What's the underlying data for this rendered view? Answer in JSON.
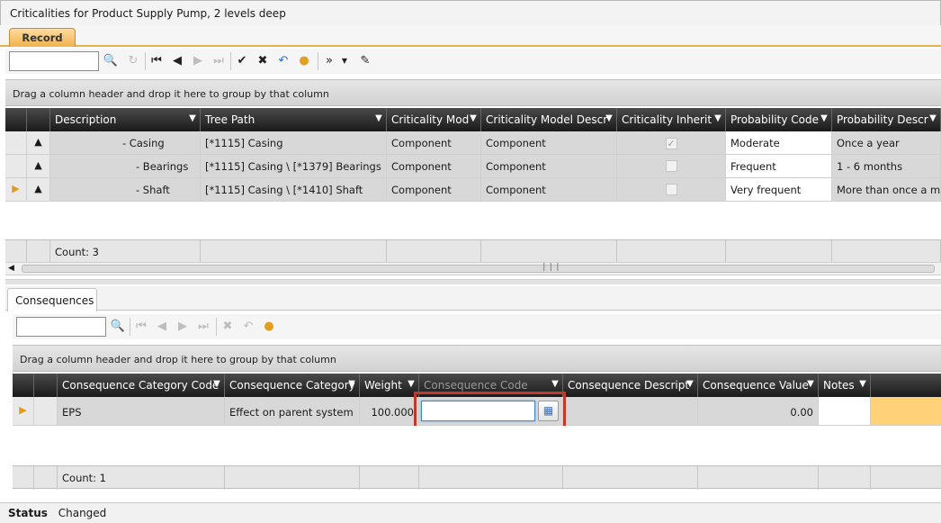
{
  "window": {
    "title": "Criticalities for Product Supply Pump, 2 levels deep"
  },
  "tabs": {
    "record": "Record",
    "consequences": "Consequences"
  },
  "group_panel_text": "Drag a column header and drop it here to group by that column",
  "top_grid": {
    "columns": [
      "Description",
      "Tree Path",
      "Criticality Mod",
      "Criticality Model Descr",
      "Criticality Inherit",
      "Probability Code",
      "Probability Descr"
    ],
    "rows": [
      {
        "description": "- Casing",
        "tree_path": "[*1115] Casing",
        "model": "Component",
        "model_descr": "Component",
        "inherit": true,
        "prob_code": "Moderate",
        "prob_descr": "Once a year"
      },
      {
        "description": "- Bearings",
        "tree_path": "[*1115] Casing \\ [*1379] Bearings",
        "model": "Component",
        "model_descr": "Component",
        "inherit": false,
        "prob_code": "Frequent",
        "prob_descr": "1 - 6 months"
      },
      {
        "description": "- Shaft",
        "tree_path": "[*1115] Casing \\ [*1410] Shaft",
        "model": "Component",
        "model_descr": "Component",
        "inherit": false,
        "prob_code": "Very frequent",
        "prob_descr": "More than once a mo"
      }
    ],
    "count": "Count: 3"
  },
  "bottom_grid": {
    "columns": [
      "Consequence Category Code",
      "Consequence Category",
      "Weight",
      "Consequence Code",
      "Consequence Descript",
      "Consequence Value",
      "Notes"
    ],
    "rows": [
      {
        "cat_code": "EPS",
        "category": "Effect on parent system",
        "weight": "100.000",
        "code": "",
        "descr": "",
        "value": "0.00",
        "notes": ""
      }
    ],
    "count": "Count: 1"
  },
  "status": {
    "label": "Status",
    "value": "Changed"
  },
  "colors": {
    "accent_orange": "#f1b04c",
    "highlight_red": "#c0392b",
    "selected_row_fill": "#ffd27a"
  }
}
